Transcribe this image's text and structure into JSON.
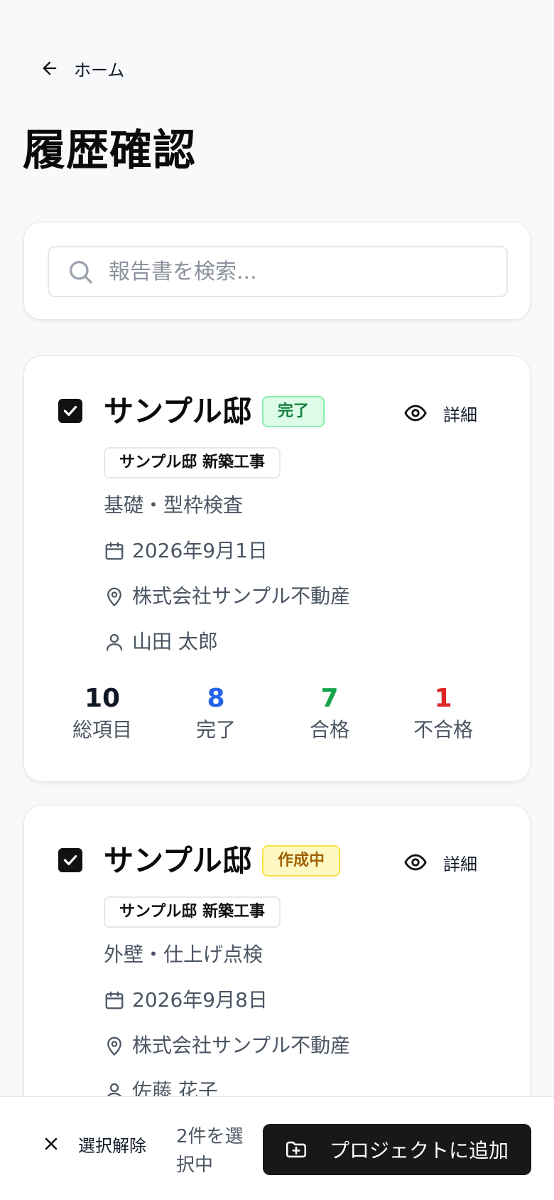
{
  "header": {
    "back_label": "ホーム",
    "title": "履歴確認"
  },
  "search": {
    "placeholder": "報告書を検索..."
  },
  "reports": [
    {
      "title": "サンプル邸",
      "status": "完了",
      "project": "サンプル邸 新築工事",
      "inspection": "基礎・型枠検査",
      "date": "2026年9月1日",
      "location": "株式会社サンプル不動産",
      "inspector": "山田 太郎",
      "detail_label": "詳細",
      "checked": true,
      "stats": {
        "total": "10",
        "total_label": "総項目",
        "done": "8",
        "done_label": "完了",
        "pass": "7",
        "pass_label": "合格",
        "fail": "1",
        "fail_label": "不合格"
      }
    },
    {
      "title": "サンプル邸",
      "status": "作成中",
      "project": "サンプル邸 新築工事",
      "inspection": "外壁・仕上げ点検",
      "date": "2026年9月8日",
      "location": "株式会社サンプル不動産",
      "inspector": "佐藤 花子",
      "detail_label": "詳細",
      "checked": true
    }
  ],
  "selection_bar": {
    "clear_label": "選択解除",
    "count_text": "2件を選択中",
    "add_label": "プロジェクトに追加"
  },
  "colors": {
    "status_done": "#15803d",
    "status_draft": "#a16207",
    "stat_done": "#2563eb",
    "stat_pass": "#16a34a",
    "stat_fail": "#dc2626",
    "primary_button": "#18181b"
  }
}
